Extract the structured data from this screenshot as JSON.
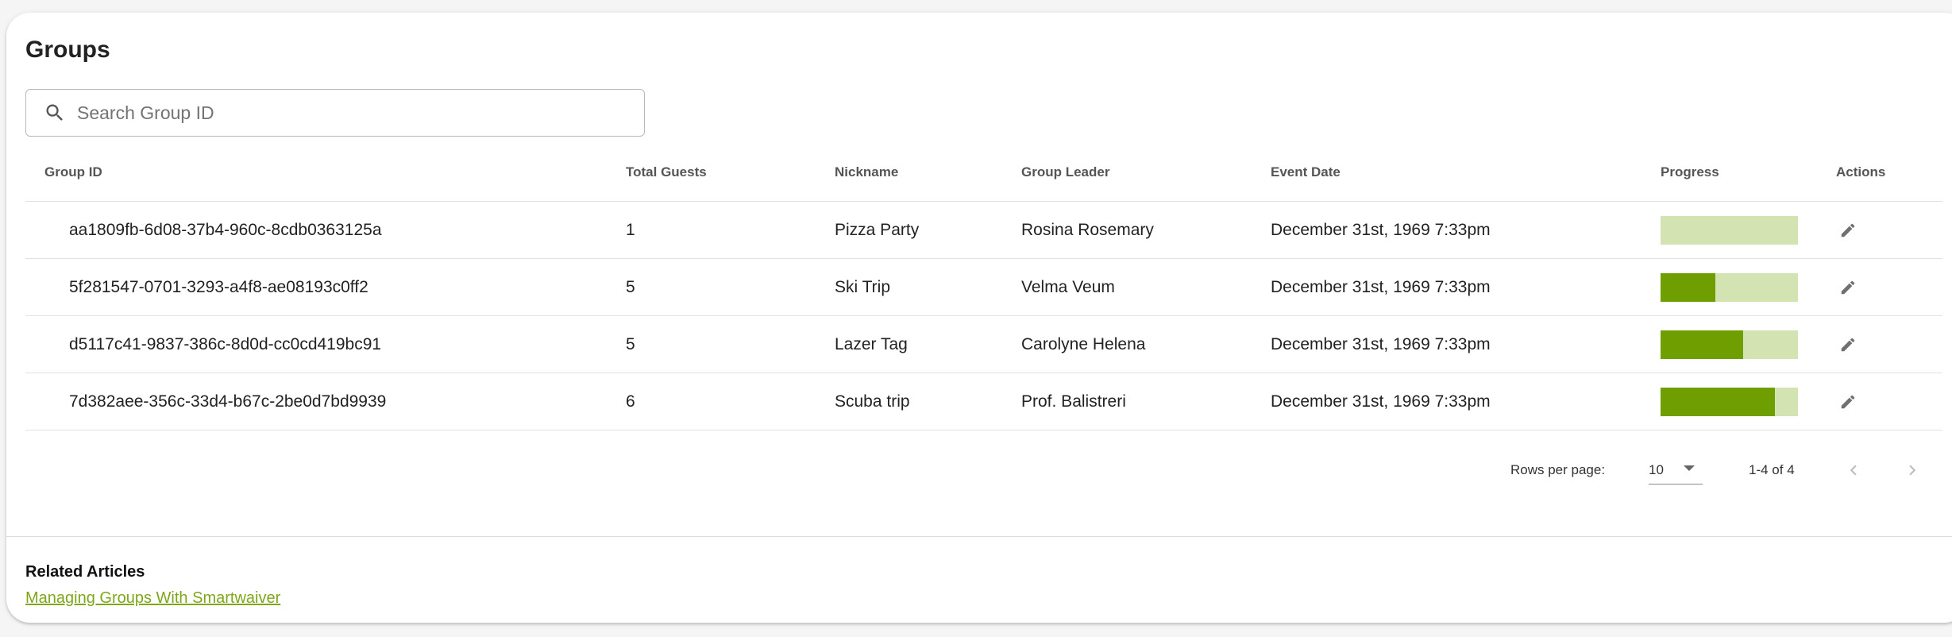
{
  "page": {
    "title": "Groups"
  },
  "search": {
    "placeholder": "Search Group ID",
    "value": ""
  },
  "table": {
    "headers": {
      "group_id": "Group ID",
      "total_guests": "Total Guests",
      "nickname": "Nickname",
      "group_leader": "Group Leader",
      "event_date": "Event Date",
      "progress": "Progress",
      "actions": "Actions"
    },
    "rows": [
      {
        "group_id": "aa1809fb-6d08-37b4-960c-8cdb0363125a",
        "total_guests": "1",
        "nickname": "Pizza Party",
        "group_leader": "Rosina Rosemary",
        "event_date": "December 31st, 1969 7:33pm",
        "progress": 0.0
      },
      {
        "group_id": "5f281547-0701-3293-a4f8-ae08193c0ff2",
        "total_guests": "5",
        "nickname": "Ski Trip",
        "group_leader": "Velma Veum",
        "event_date": "December 31st, 1969 7:33pm",
        "progress": 0.4
      },
      {
        "group_id": "d5117c41-9837-386c-8d0d-cc0cd419bc91",
        "total_guests": "5",
        "nickname": "Lazer Tag",
        "group_leader": "Carolyne Helena",
        "event_date": "December 31st, 1969 7:33pm",
        "progress": 0.6
      },
      {
        "group_id": "7d382aee-356c-33d4-b67c-2be0d7bd9939",
        "total_guests": "6",
        "nickname": "Scuba trip",
        "group_leader": "Prof. Balistreri",
        "event_date": "December 31st, 1969 7:33pm",
        "progress": 0.833
      }
    ]
  },
  "pagination": {
    "rows_per_page_label": "Rows per page:",
    "rows_per_page": "10",
    "range": "1-4 of 4"
  },
  "related": {
    "title": "Related Articles",
    "link": "Managing Groups With Smartwaiver"
  },
  "colors": {
    "accent": "#6e9e00",
    "progress_track": "#d3e3b1",
    "link": "#7fa61a"
  },
  "icons": {
    "search": "search-icon",
    "edit": "pencil-icon",
    "dropdown": "chevron-down-icon",
    "prev": "chevron-left-icon",
    "next": "chevron-right-icon"
  }
}
